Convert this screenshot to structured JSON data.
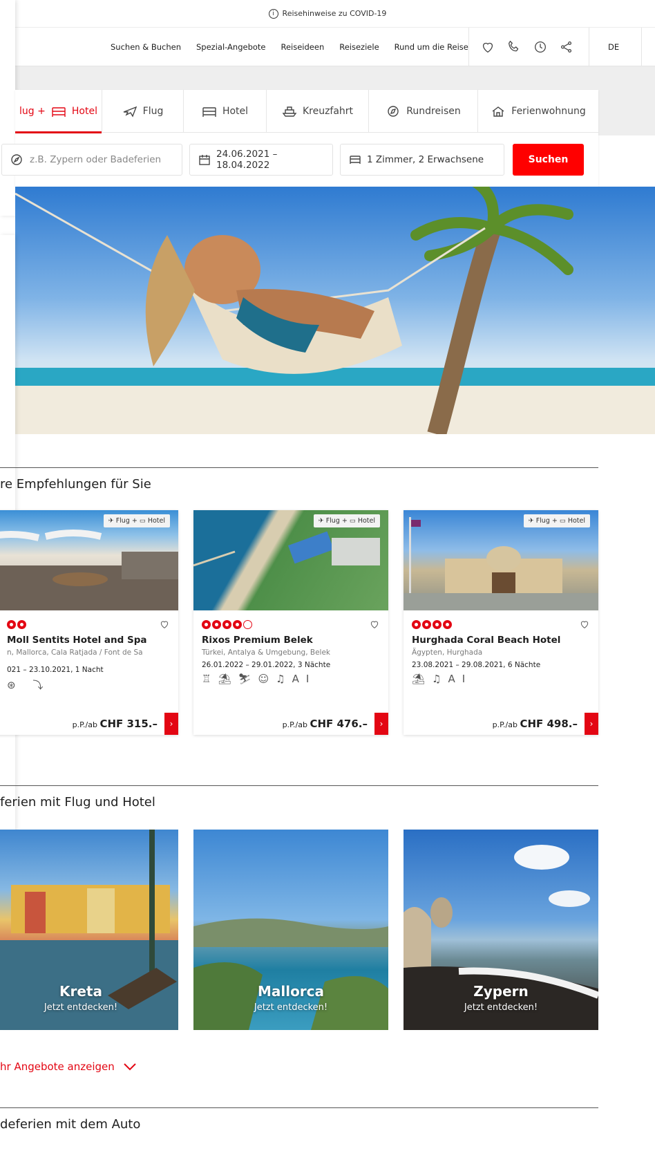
{
  "covid_bar": {
    "label": "Reisehinweise zu COVID-19"
  },
  "nav": {
    "items": [
      "Suchen & Buchen",
      "Spezial-Angebote",
      "Reiseideen",
      "Reiseziele",
      "Rund um die Reise"
    ],
    "lang": "DE"
  },
  "search": {
    "tabs": [
      "lug + ",
      "Hotel",
      "Flug",
      "Hotel",
      "Kreuzfahrt",
      "Rundreisen",
      "Ferienwohnung"
    ],
    "destination_placeholder": "z.B. Zypern oder Badeferien",
    "dates": "24.06.2021 – 18.04.2022",
    "rooms": "1 Zimmer, 2 Erwachsene",
    "button": "Suchen"
  },
  "recommend": {
    "title": "re Empfehlungen für Sie",
    "badge_flug": "Flug +",
    "badge_hotel": "Hotel",
    "price_prefix": "p.P./ab",
    "cards": [
      {
        "name": "Moll Sentits Hotel and Spa",
        "location": "n, Mallorca, Cala Ratjada / Font de Sa",
        "dates": "021 – 23.10.2021, 1 Nacht",
        "amenities": "⊛ ⤵",
        "price": "CHF 315.–",
        "stars": 2,
        "half": 0
      },
      {
        "name": "Rixos Premium Belek",
        "location": "Türkei, Antalya & Umgebung, Belek",
        "dates": "26.01.2022 – 29.01.2022, 3 Nächte",
        "amenities": "♖⛱⛷☺♫AI",
        "price": "CHF 476.–",
        "stars": 4,
        "half": 1
      },
      {
        "name": "Hurghada Coral Beach Hotel",
        "location": "Ägypten, Hurghada",
        "dates": "23.08.2021 – 29.08.2021, 6 Nächte",
        "amenities": "⛱♫AI",
        "price": "CHF 498.–",
        "stars": 4,
        "half": 0
      }
    ]
  },
  "destinations": {
    "title": "ferien mit Flug und Hotel",
    "cards": [
      {
        "name": "Kreta",
        "cta": "Jetzt entdecken!"
      },
      {
        "name": "Mallorca",
        "cta": "Jetzt entdecken!"
      },
      {
        "name": "Zypern",
        "cta": "Jetzt entdecken!"
      }
    ],
    "more": "hr Angebote anzeigen"
  },
  "auto": {
    "title": "deferien mit dem Auto"
  },
  "colors": {
    "brand_red": "#e30613",
    "search_red": "#ff0000"
  }
}
